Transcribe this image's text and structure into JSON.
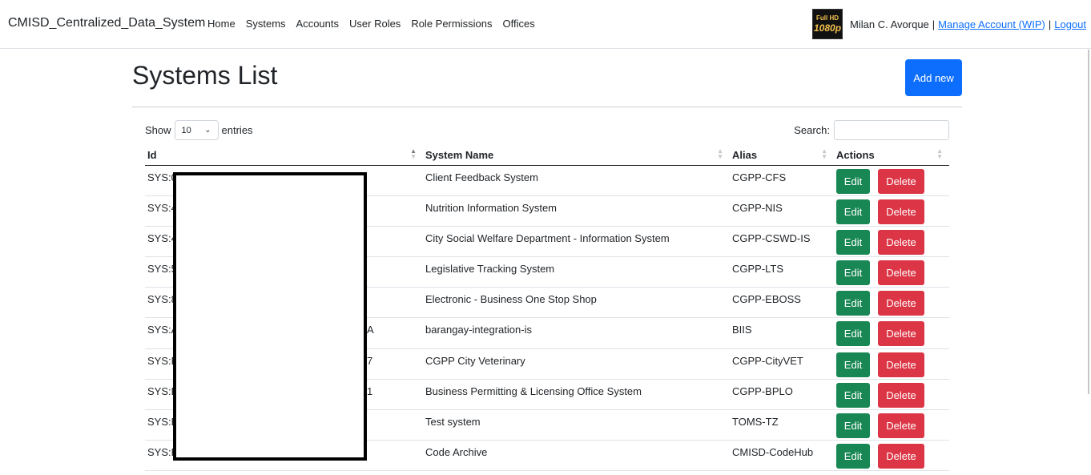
{
  "app": {
    "brand": "CMISD_Centralized_Data_System"
  },
  "nav": {
    "items": [
      "Home",
      "Systems",
      "Accounts",
      "User Roles",
      "Role Permissions",
      "Offices"
    ]
  },
  "user": {
    "avatar_text_top": "Full HD",
    "avatar_text_bottom": "1080p",
    "name": "Milan C. Avorque",
    "manage_link": "Manage Account (WIP)",
    "logout_link": "Logout",
    "separator": "|"
  },
  "page": {
    "title": "Systems List",
    "add_button": "Add new"
  },
  "controls": {
    "show_label": "Show",
    "page_size": "10",
    "entries_label": "entries",
    "search_label": "Search:",
    "search_value": ""
  },
  "table": {
    "headers": [
      "Id",
      "System Name",
      "Alias",
      "Actions"
    ],
    "edit_label": "Edit",
    "delete_label": "Delete",
    "rows": [
      {
        "id": "SYS:0",
        "name": "Client Feedback System",
        "alias": "CGPP-CFS"
      },
      {
        "id": "SYS:4",
        "name": "Nutrition Information System",
        "alias": "CGPP-NIS"
      },
      {
        "id": "SYS:4",
        "name": "City Social Welfare Department - Information System",
        "alias": "CGPP-CSWD-IS"
      },
      {
        "id": "SYS:5",
        "name": "Legislative Tracking System",
        "alias": "CGPP-LTS"
      },
      {
        "id": "SYS:8",
        "name": "Electronic - Business One Stop Shop",
        "alias": "CGPP-EBOSS"
      },
      {
        "id": "SYS:A",
        "id_tail": "A",
        "name": "barangay-integration-is",
        "alias": "BIIS"
      },
      {
        "id": "SYS:B",
        "id_tail": "7",
        "name": "CGPP City Veterinary",
        "alias": "CGPP-CityVET"
      },
      {
        "id": "SYS:B",
        "id_tail": "1",
        "name": "Business Permitting & Licensing Office System",
        "alias": "CGPP-BPLO"
      },
      {
        "id": "SYS:B",
        "name": "Test system",
        "alias": "TOMS-TZ"
      },
      {
        "id": "SYS:E",
        "name": "Code Archive",
        "alias": "CMISD-CodeHub"
      }
    ]
  },
  "colors": {
    "primary": "#0d6efd",
    "success": "#198754",
    "danger": "#dc3545"
  }
}
